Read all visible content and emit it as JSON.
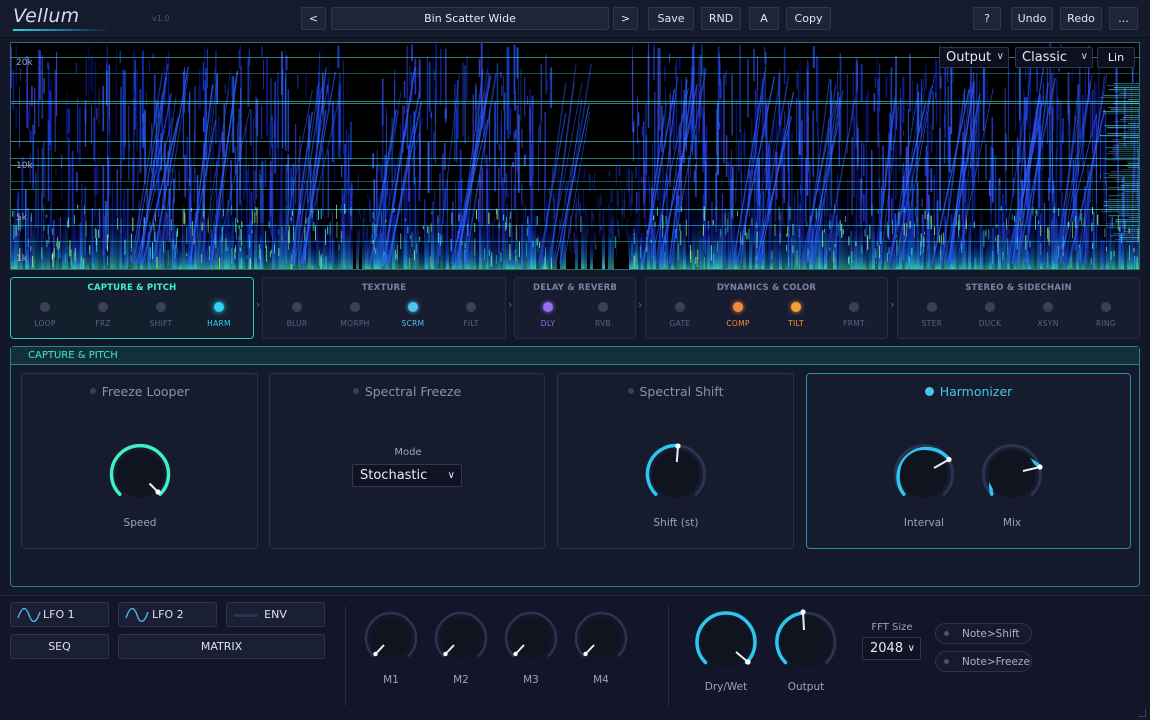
{
  "header": {
    "logo": "Vellum",
    "version": "v1.0",
    "prev_label": "<",
    "preset_name": "Bin Scatter Wide",
    "next_label": ">",
    "save_label": "Save",
    "rnd_label": "RND",
    "ab_label": "A",
    "copy_label": "Copy",
    "help_label": "?",
    "undo_label": "Undo",
    "redo_label": "Redo",
    "more_label": "..."
  },
  "spectrogram": {
    "freq_labels": [
      "20k",
      "10k",
      "5k",
      "1k"
    ],
    "view_select": "Output",
    "style_select": "Classic",
    "scale_toggle": "Lin"
  },
  "modules": [
    {
      "title": "CAPTURE & PITCH",
      "slots": [
        {
          "label": "LOOP",
          "active": false
        },
        {
          "label": "FRZ",
          "active": false
        },
        {
          "label": "SHIFT",
          "active": false
        },
        {
          "label": "HARM",
          "active": true,
          "color": "#2ed3f0"
        }
      ]
    },
    {
      "title": "TEXTURE",
      "slots": [
        {
          "label": "BLUR",
          "active": false
        },
        {
          "label": "MORPH",
          "active": false
        },
        {
          "label": "SCRM",
          "active": true,
          "color": "#4cc4ef"
        },
        {
          "label": "FILT",
          "active": false
        }
      ]
    },
    {
      "title": "DELAY & REVERB",
      "slots": [
        {
          "label": "DLY",
          "active": true,
          "color": "#9a6cf0"
        },
        {
          "label": "RVB",
          "active": false
        }
      ]
    },
    {
      "title": "DYNAMICS & COLOR",
      "slots": [
        {
          "label": "GATE",
          "active": false
        },
        {
          "label": "COMP",
          "active": true,
          "color": "#f28a3c"
        },
        {
          "label": "TILT",
          "active": true,
          "color": "#f2a03c"
        },
        {
          "label": "FRMT",
          "active": false
        }
      ]
    },
    {
      "title": "STEREO & SIDECHAIN",
      "slots": [
        {
          "label": "STER",
          "active": false
        },
        {
          "label": "DUCK",
          "active": false
        },
        {
          "label": "XSYN",
          "active": false
        },
        {
          "label": "RING",
          "active": false
        }
      ]
    }
  ],
  "panel": {
    "title": "CAPTURE & PITCH",
    "cards": [
      {
        "title": "Freeze Looper",
        "on": false,
        "knob_label": "Speed"
      },
      {
        "title": "Spectral Freeze",
        "on": false,
        "mode_label": "Mode",
        "mode_value": "Stochastic"
      },
      {
        "title": "Spectral Shift",
        "on": false,
        "knob_label": "Shift (st)"
      },
      {
        "title": "Harmonizer",
        "on": true,
        "knob1_label": "Interval",
        "knob2_label": "Mix"
      }
    ]
  },
  "bottom": {
    "lfo1": "LFO 1",
    "lfo2": "LFO 2",
    "env": "ENV",
    "seq": "SEQ",
    "matrix": "MATRIX",
    "macros": [
      "M1",
      "M2",
      "M3",
      "M4"
    ],
    "drywet_label": "Dry/Wet",
    "output_label": "Output",
    "fft_label": "FFT Size",
    "fft_value": "2048",
    "note_shift": "Note>Shift",
    "note_freeze": "Note>Freeze"
  },
  "colors": {
    "accent": "#2ed3f0",
    "teal": "#3ff0d8",
    "bg": "#131829"
  }
}
